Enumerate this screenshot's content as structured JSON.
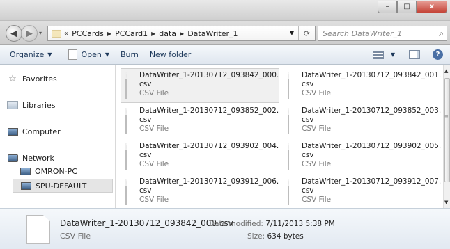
{
  "window": {
    "minimize": "–",
    "maximize": "□",
    "close": "x"
  },
  "nav": {
    "back_icon": "◀",
    "forward_icon": "▶"
  },
  "address": {
    "overflow": "«",
    "crumbs": [
      "PCCards",
      "PCCard1",
      "data",
      "DataWriter_1"
    ],
    "refresh_icon": "⟳"
  },
  "search": {
    "placeholder": "Search DataWriter_1"
  },
  "toolbar": {
    "organize": "Organize",
    "open": "Open",
    "burn": "Burn",
    "new_folder": "New folder",
    "help": "?"
  },
  "sidebar": {
    "favorites": "Favorites",
    "libraries": "Libraries",
    "computer": "Computer",
    "network": "Network",
    "network_children": [
      "OMRON-PC",
      "SPU-DEFAULT"
    ]
  },
  "files": [
    {
      "name": "DataWriter_1-20130712_093842_000.",
      "ext": "csv",
      "type": "CSV File"
    },
    {
      "name": "DataWriter_1-20130712_093842_001.",
      "ext": "csv",
      "type": "CSV File"
    },
    {
      "name": "DataWriter_1-20130712_093852_002.",
      "ext": "csv",
      "type": "CSV File"
    },
    {
      "name": "DataWriter_1-20130712_093852_003.",
      "ext": "csv",
      "type": "CSV File"
    },
    {
      "name": "DataWriter_1-20130712_093902_004.",
      "ext": "csv",
      "type": "CSV File"
    },
    {
      "name": "DataWriter_1-20130712_093902_005.",
      "ext": "csv",
      "type": "CSV File"
    },
    {
      "name": "DataWriter_1-20130712_093912_006.",
      "ext": "csv",
      "type": "CSV File"
    },
    {
      "name": "DataWriter_1-20130712_093912_007.",
      "ext": "csv",
      "type": "CSV File"
    }
  ],
  "details": {
    "name": "DataWriter_1-20130712_093842_000.csv",
    "type": "CSV File",
    "modified_label": "Date modified:",
    "modified_value": "7/11/2013 5:38 PM",
    "size_label": "Size:",
    "size_value": "634 bytes"
  }
}
